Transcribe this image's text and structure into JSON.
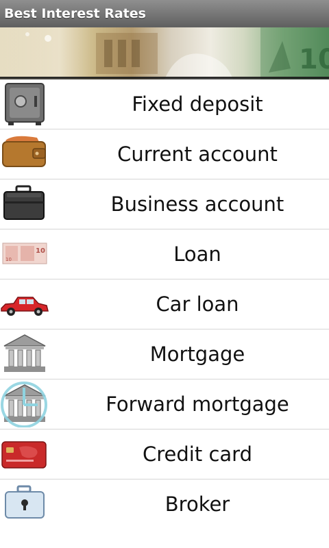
{
  "app": {
    "title": "Best Interest Rates"
  },
  "banner": {
    "image": "euro-banknotes-banner"
  },
  "colors": {
    "titlebar": "#6f6f6f",
    "text": "#111111",
    "divider": "#d6d6d6"
  },
  "menu": [
    {
      "label": "Fixed deposit",
      "icon": "safe-icon"
    },
    {
      "label": "Current account",
      "icon": "wallet-icon"
    },
    {
      "label": "Business account",
      "icon": "briefcase-icon"
    },
    {
      "label": "Loan",
      "icon": "banknote-icon"
    },
    {
      "label": "Car loan",
      "icon": "car-icon"
    },
    {
      "label": "Mortgage",
      "icon": "bank-icon"
    },
    {
      "label": "Forward mortgage",
      "icon": "bank-clock-icon"
    },
    {
      "label": "Credit card",
      "icon": "credit-card-icon"
    },
    {
      "label": "Broker",
      "icon": "locked-case-icon"
    }
  ]
}
